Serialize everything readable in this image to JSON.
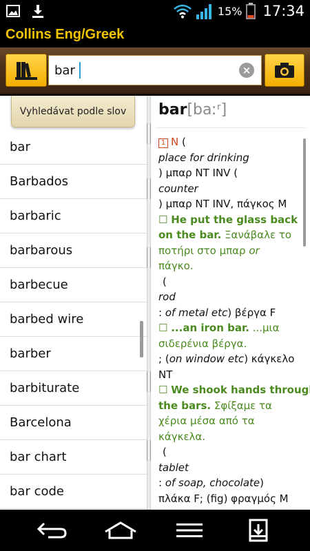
{
  "status": {
    "battery": "15%",
    "time": "17:34",
    "icons": [
      "image-icon",
      "download-icon",
      "wifi-icon",
      "signal-icon",
      "battery-icon"
    ]
  },
  "app": {
    "title": "Collins Eng/Greek",
    "accent_color": "#f2c300"
  },
  "search": {
    "value": "bar",
    "clear_icon": "clear-icon",
    "book_icon": "bookshelf-icon",
    "camera_icon": "camera-icon"
  },
  "mode_tab": {
    "label": "Vyhledávat podle slov"
  },
  "word_list": [
    "bar",
    "Barbados",
    "barbaric",
    "barbarous",
    "barbecue",
    "barbed wire",
    "barber",
    "barbiturate",
    "Barcelona",
    "bar chart",
    "bar code"
  ],
  "entry": {
    "headword": "bar",
    "pronunciation": "[baːʳ]",
    "sense_number": "1",
    "pos": "N",
    "line_01a": " (",
    "line_02": "place for drinking",
    "line_03": ") μπαρ NT INV (",
    "line_04": "counter",
    "line_05": ") μπαρ NT INV, πάγκος M",
    "ex1_marker": "☐",
    "ex1_en_a": "He put the glass back",
    "ex1_en_b": "on the bar.",
    "ex1_gr_a": " Ξανάβαλε το",
    "ex1_gr_b": "ποτήρι στο μπαρ ",
    "ex1_or": "or",
    "ex1_gr_c": "πάγκο.",
    "line_10": "(",
    "line_11": "rod",
    "line_12a": ": ",
    "line_12b": "of metal etc",
    "line_12c": ") βέργα F",
    "ex2_marker": "☐",
    "ex2_en": "...an iron bar.",
    "ex2_gr_a": " ...μια",
    "ex2_gr_b": "σιδερένια βέργα.",
    "line_15a": "; (",
    "line_15b": "on window etc",
    "line_15c": ") κάγκελο",
    "line_16": "NT",
    "ex3_marker": "☐",
    "ex3_en_a": "We shook hands through",
    "ex3_en_b": "the bars.",
    "ex3_gr_a": " Σφίξαμε τα",
    "ex3_gr_b": "χέρια μέσα από τα",
    "ex3_gr_c": "κάγκελα.",
    "line_21": "(",
    "line_22": "tablet",
    "line_23a": ": ",
    "line_23b": "of soap, chocolate",
    "line_23c": ")",
    "line_24": "πλάκα F; (fig) φραγμός M"
  },
  "nav": {
    "icons": [
      "back-icon",
      "home-icon",
      "menu-icon",
      "save-icon"
    ]
  }
}
